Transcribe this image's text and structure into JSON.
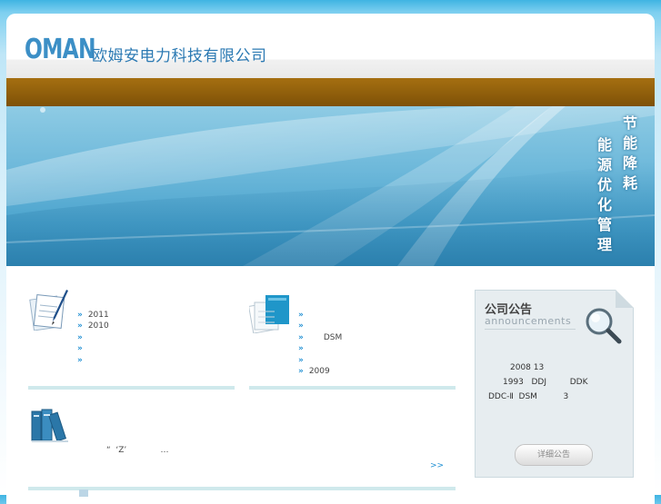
{
  "header": {
    "logo_latin": "OMAN",
    "logo_cn": "欧姆安电力科技有限公司"
  },
  "banner": {
    "slogan_col_right": "节能降耗",
    "slogan_col_left": "能源优化管理"
  },
  "news_left": {
    "items": [
      "2011",
      "2010",
      "",
      "",
      ""
    ],
    "icon": "document-pen-icon"
  },
  "news_middle": {
    "items": [
      "",
      "",
      "DSM",
      "",
      "",
      "2009"
    ],
    "icon": "papers-icon"
  },
  "intro": {
    "icon": "books-icon",
    "text": "“  ‘Z’             …",
    "more": ">>"
  },
  "notice": {
    "title": "公司公告",
    "subtitle": "announcements",
    "icon": "magnifier-icon",
    "line1": "2008 13",
    "line2": "1993   DDJ         DDK",
    "line3": "DDC-Ⅱ  DSM          3",
    "button": "详细公告"
  },
  "colors": {
    "nav_brown": "#8e5d0c",
    "accent_blue": "#1e8fd3",
    "bar_teal": "#cfe9ec"
  }
}
